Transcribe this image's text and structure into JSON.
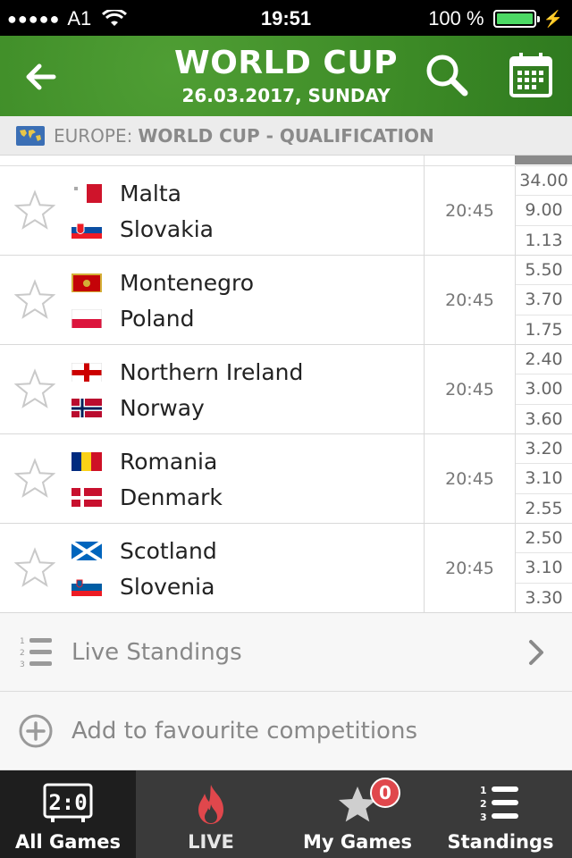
{
  "status_bar": {
    "signal": "●●●●●",
    "carrier": "A1",
    "time": "19:51",
    "battery": "100 %",
    "battery_color": "#4cd964"
  },
  "header": {
    "title": "WORLD CUP",
    "subtitle": "26.03.2017, SUNDAY",
    "back_icon": "arrow-left-icon",
    "search_icon": "search-icon",
    "calendar_icon": "calendar-icon",
    "brand_color": "#3c8a26"
  },
  "breadcrumb": {
    "region": "EUROPE:",
    "competition": "WORLD CUP - QUALIFICATION",
    "icon": "world-map-icon"
  },
  "matches": [
    {
      "home": "Malta",
      "away": "Slovakia",
      "time": "20:45",
      "odds": [
        "34.00",
        "9.00",
        "1.13"
      ]
    },
    {
      "home": "Montenegro",
      "away": "Poland",
      "time": "20:45",
      "odds": [
        "5.50",
        "3.70",
        "1.75"
      ]
    },
    {
      "home": "Northern Ireland",
      "away": "Norway",
      "time": "20:45",
      "odds": [
        "2.40",
        "3.00",
        "3.60"
      ]
    },
    {
      "home": "Romania",
      "away": "Denmark",
      "time": "20:45",
      "odds": [
        "3.20",
        "3.10",
        "2.55"
      ]
    },
    {
      "home": "Scotland",
      "away": "Slovenia",
      "time": "20:45",
      "odds": [
        "2.50",
        "3.10",
        "3.30"
      ]
    }
  ],
  "live_standings": {
    "label": "Live Standings",
    "icon": "numbered-list-icon"
  },
  "add_favourite": {
    "label": "Add to favourite competitions",
    "icon": "plus-circle-icon"
  },
  "tabs": [
    {
      "label": "All Games",
      "icon": "scoreboard-icon",
      "active": true
    },
    {
      "label": "LIVE",
      "icon": "flame-icon",
      "active": false
    },
    {
      "label": "My Games",
      "icon": "star-icon",
      "badge": "0",
      "active": false
    },
    {
      "label": "Standings",
      "icon": "numbered-list-icon",
      "active": false
    }
  ]
}
